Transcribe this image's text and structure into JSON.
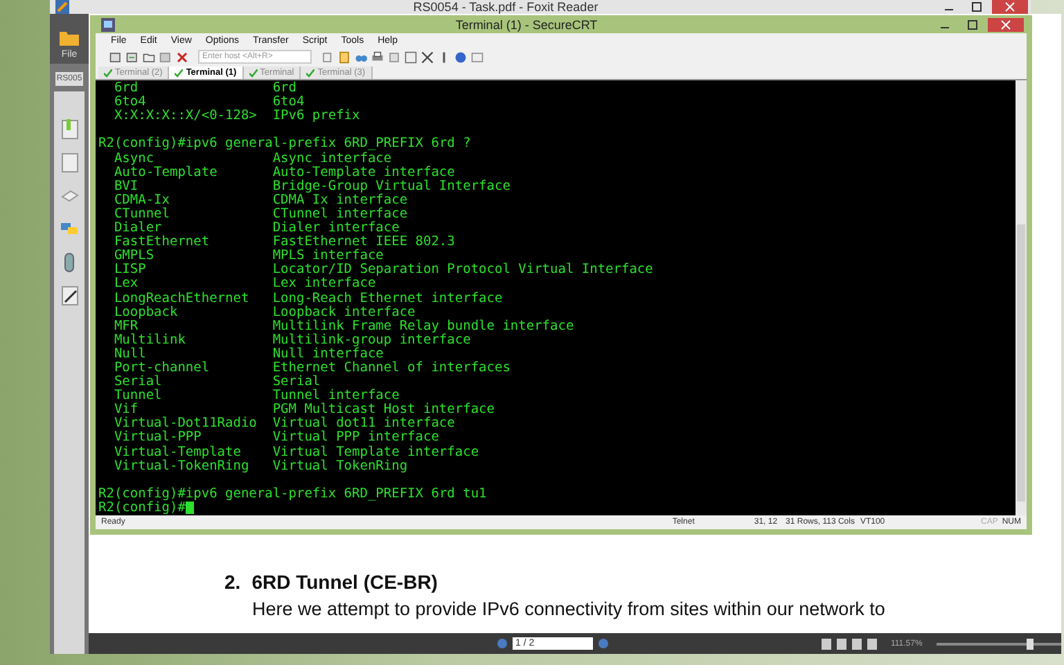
{
  "foxit": {
    "title": "RS0054 - Task.pdf - Foxit Reader",
    "file_label": "File",
    "doc_tab": "RS005",
    "page_box": "1 / 2",
    "zoom": "111.57%",
    "zoom_slider": {
      "level": 0.75
    }
  },
  "securecrt": {
    "title": "Terminal (1) - SecureCRT",
    "menu": [
      "File",
      "Edit",
      "View",
      "Options",
      "Transfer",
      "Script",
      "Tools",
      "Help"
    ],
    "host_placeholder": "Enter host <Alt+R>",
    "tabs": [
      {
        "label": "Terminal (2)",
        "selected": false
      },
      {
        "label": "Terminal (1)",
        "selected": true
      },
      {
        "label": "Terminal",
        "selected": false
      },
      {
        "label": "Terminal (3)",
        "selected": false
      }
    ],
    "lines": [
      {
        "kind": "pair",
        "col_1": "6rd",
        "col_2": "6rd"
      },
      {
        "kind": "pair",
        "col_1": "6to4",
        "col_2": "6to4"
      },
      {
        "kind": "pair",
        "col_1": "X:X:X:X::X/<0-128>",
        "col_2": "IPv6 prefix"
      },
      {
        "kind": "blank"
      },
      {
        "kind": "prompt",
        "text": "R2(config)#ipv6 general-prefix 6RD_PREFIX 6rd ?"
      },
      {
        "kind": "pair",
        "col_1": "Async",
        "col_2": "Async interface"
      },
      {
        "kind": "pair",
        "col_1": "Auto-Template",
        "col_2": "Auto-Template interface"
      },
      {
        "kind": "pair",
        "col_1": "BVI",
        "col_2": "Bridge-Group Virtual Interface"
      },
      {
        "kind": "pair",
        "col_1": "CDMA-Ix",
        "col_2": "CDMA Ix interface"
      },
      {
        "kind": "pair",
        "col_1": "CTunnel",
        "col_2": "CTunnel interface"
      },
      {
        "kind": "pair",
        "col_1": "Dialer",
        "col_2": "Dialer interface"
      },
      {
        "kind": "pair",
        "col_1": "FastEthernet",
        "col_2": "FastEthernet IEEE 802.3"
      },
      {
        "kind": "pair",
        "col_1": "GMPLS",
        "col_2": "MPLS interface"
      },
      {
        "kind": "pair",
        "col_1": "LISP",
        "col_2": "Locator/ID Separation Protocol Virtual Interface"
      },
      {
        "kind": "pair",
        "col_1": "Lex",
        "col_2": "Lex interface"
      },
      {
        "kind": "pair",
        "col_1": "LongReachEthernet",
        "col_2": "Long-Reach Ethernet interface"
      },
      {
        "kind": "pair",
        "col_1": "Loopback",
        "col_2": "Loopback interface"
      },
      {
        "kind": "pair",
        "col_1": "MFR",
        "col_2": "Multilink Frame Relay bundle interface"
      },
      {
        "kind": "pair",
        "col_1": "Multilink",
        "col_2": "Multilink-group interface"
      },
      {
        "kind": "pair",
        "col_1": "Null",
        "col_2": "Null interface"
      },
      {
        "kind": "pair",
        "col_1": "Port-channel",
        "col_2": "Ethernet Channel of interfaces"
      },
      {
        "kind": "pair",
        "col_1": "Serial",
        "col_2": "Serial"
      },
      {
        "kind": "pair",
        "col_1": "Tunnel",
        "col_2": "Tunnel interface"
      },
      {
        "kind": "pair",
        "col_1": "Vif",
        "col_2": "PGM Multicast Host interface"
      },
      {
        "kind": "pair",
        "col_1": "Virtual-Dot11Radio",
        "col_2": "Virtual dot11 interface"
      },
      {
        "kind": "pair",
        "col_1": "Virtual-PPP",
        "col_2": "Virtual PPP interface"
      },
      {
        "kind": "pair",
        "col_1": "Virtual-Template",
        "col_2": "Virtual Template interface"
      },
      {
        "kind": "pair",
        "col_1": "Virtual-TokenRing",
        "col_2": "Virtual TokenRing"
      },
      {
        "kind": "blank"
      },
      {
        "kind": "prompt",
        "text": "R2(config)#ipv6 general-prefix 6RD_PREFIX 6rd tu1"
      },
      {
        "kind": "prompt",
        "text": "R2(config)#",
        "cursor": true
      }
    ],
    "status": {
      "ready": "Ready",
      "protocol": "Telnet",
      "position": "31, 12",
      "size": "31 Rows, 113 Cols",
      "emulation": "VT100",
      "keys": [
        {
          "label": "CAP",
          "on": false
        },
        {
          "label": "NUM",
          "on": true
        }
      ]
    }
  },
  "pdf": {
    "number": "2.",
    "heading": "6RD Tunnel (CE-BR)",
    "paragraph": "Here we attempt to provide IPv6 connectivity from sites within our network to"
  }
}
